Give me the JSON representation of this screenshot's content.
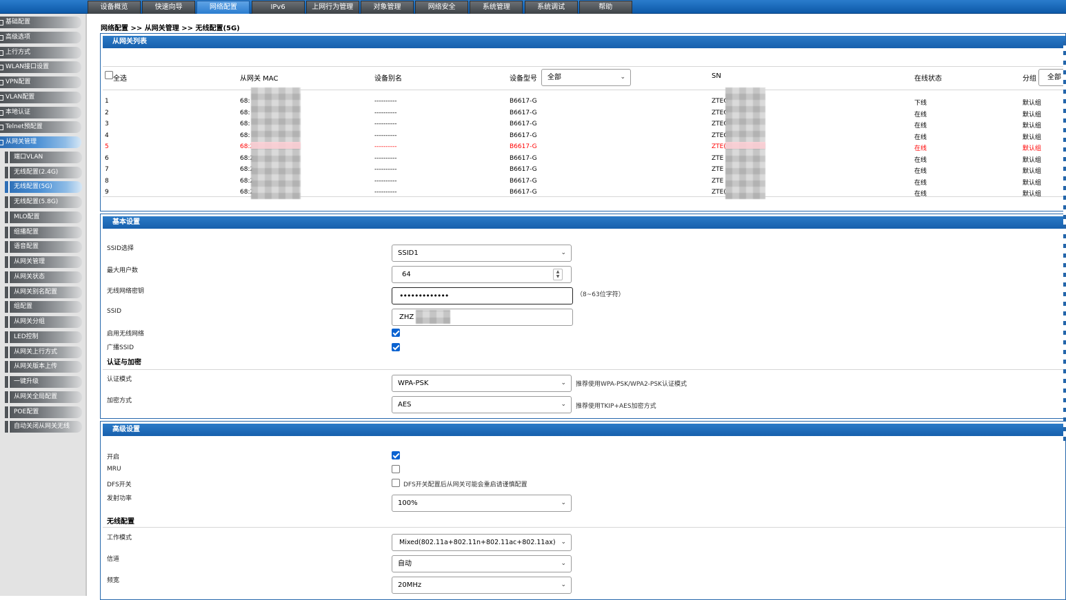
{
  "nav": {
    "tabs": [
      "设备概览",
      "快速向导",
      "网络配置",
      "IPv6",
      "上网行为管理",
      "对象管理",
      "网络安全",
      "系统管理",
      "系统调试",
      "帮助"
    ],
    "active_index": 2
  },
  "sidebar": {
    "items": [
      {
        "label": "基础配置",
        "level": 1
      },
      {
        "label": "高级选项",
        "level": 1
      },
      {
        "label": "上行方式",
        "level": 1
      },
      {
        "label": "WLAN接口设置",
        "level": 1
      },
      {
        "label": "VPN配置",
        "level": 1
      },
      {
        "label": "VLAN配置",
        "level": 1
      },
      {
        "label": "本地认证",
        "level": 1
      },
      {
        "label": "Telnet预配置",
        "level": 1
      },
      {
        "label": "从网关管理",
        "level": 1,
        "active": true
      },
      {
        "label": "端口VLAN",
        "level": 2
      },
      {
        "label": "无线配置(2.4G)",
        "level": 2
      },
      {
        "label": "无线配置(5G)",
        "level": 2,
        "active": true
      },
      {
        "label": "无线配置(5.8G)",
        "level": 2
      },
      {
        "label": "MLO配置",
        "level": 2
      },
      {
        "label": "组播配置",
        "level": 2
      },
      {
        "label": "语音配置",
        "level": 2
      },
      {
        "label": "从网关管理",
        "level": 2
      },
      {
        "label": "从网关状态",
        "level": 2
      },
      {
        "label": "从网关别名配置",
        "level": 2
      },
      {
        "label": "组配置",
        "level": 2
      },
      {
        "label": "从网关分组",
        "level": 2
      },
      {
        "label": "LED控制",
        "level": 2
      },
      {
        "label": "从网关上行方式",
        "level": 2
      },
      {
        "label": "从网关版本上传",
        "level": 2
      },
      {
        "label": "一键升级",
        "level": 2
      },
      {
        "label": "从网关全局配置",
        "level": 2
      },
      {
        "label": "POE配置",
        "level": 2
      },
      {
        "label": "自动关闭从网关无线",
        "level": 2
      }
    ]
  },
  "breadcrumb": "网络配置 >> 从网关管理 >> 无线配置(5G)",
  "gateway_list": {
    "title": "从网关列表",
    "headers": {
      "select_all": "全选",
      "mac": "从网关 MAC",
      "alias": "设备别名",
      "model": "设备型号",
      "model_filter": "全部",
      "sn": "SN",
      "status": "在线状态",
      "group": "分组",
      "group_filter": "全部"
    },
    "rows": [
      {
        "index": "1",
        "mac": "68:",
        "alias": "----------",
        "model": "B6617-G",
        "sn": "ZTEG",
        "status": "下线",
        "group": "默认组",
        "highlight": false
      },
      {
        "index": "2",
        "mac": "68:",
        "alias": "----------",
        "model": "B6617-G",
        "sn": "ZTEG",
        "status": "在线",
        "group": "默认组",
        "highlight": false
      },
      {
        "index": "3",
        "mac": "68:",
        "alias": "----------",
        "model": "B6617-G",
        "sn": "ZTEC",
        "status": "在线",
        "group": "默认组",
        "highlight": false
      },
      {
        "index": "4",
        "mac": "68:",
        "alias": "----------",
        "model": "B6617-G",
        "sn": "ZTEC",
        "status": "在线",
        "group": "默认组",
        "highlight": false
      },
      {
        "index": "5",
        "mac": "68:2",
        "alias": "----------",
        "model": "B6617-G",
        "sn": "ZTE(",
        "status": "在线",
        "group": "默认组",
        "highlight": true
      },
      {
        "index": "6",
        "mac": "68:2",
        "alias": "----------",
        "model": "B6617-G",
        "sn": "ZTE",
        "status": "在线",
        "group": "默认组",
        "highlight": false
      },
      {
        "index": "7",
        "mac": "68:2",
        "alias": "----------",
        "model": "B6617-G",
        "sn": "ZTE",
        "status": "在线",
        "group": "默认组",
        "highlight": false
      },
      {
        "index": "8",
        "mac": "68:2",
        "alias": "----------",
        "model": "B6617-G",
        "sn": "ZTE",
        "status": "在线",
        "group": "默认组",
        "highlight": false
      },
      {
        "index": "9",
        "mac": "68:2",
        "alias": "----------",
        "model": "B6617-G",
        "sn": "ZTE(",
        "status": "在线",
        "group": "默认组",
        "highlight": false
      }
    ]
  },
  "basic": {
    "title": "基本设置",
    "ssid_select_label": "SSID选择",
    "ssid_select_value": "SSID1",
    "max_users_label": "最大用户数",
    "max_users_value": "64",
    "key_label": "无线网络密钥",
    "key_value": "•••••••••••••",
    "key_hint": "（8~63位字符）",
    "ssid_label": "SSID",
    "ssid_value": "ZHZ",
    "enable_wifi_label": "启用无线网络",
    "enable_wifi_checked": true,
    "broadcast_label": "广播SSID",
    "broadcast_checked": true,
    "auth_section": "认证与加密",
    "auth_mode_label": "认证模式",
    "auth_mode_value": "WPA-PSK",
    "auth_mode_hint": "推荐使用WPA-PSK/WPA2-PSK认证模式",
    "encryption_label": "加密方式",
    "encryption_value": "AES",
    "encryption_hint": "推荐使用TKIP+AES加密方式"
  },
  "advanced": {
    "title": "高级设置",
    "enable_label": "开启",
    "enable_checked": true,
    "mru_label": "MRU",
    "mru_checked": false,
    "dfs_label": "DFS开关",
    "dfs_checked": false,
    "dfs_hint": "DFS开关配置后从网关可能会重启请谨慎配置",
    "power_label": "发射功率",
    "power_value": "100%",
    "wireless_section": "无线配置",
    "work_mode_label": "工作模式",
    "work_mode_value": "Mixed(802.11a+802.11n+802.11ac+802.11ax)",
    "channel_label": "信道",
    "channel_value": "自动",
    "bandwidth_label": "频宽",
    "bandwidth_value": "20MHz"
  }
}
